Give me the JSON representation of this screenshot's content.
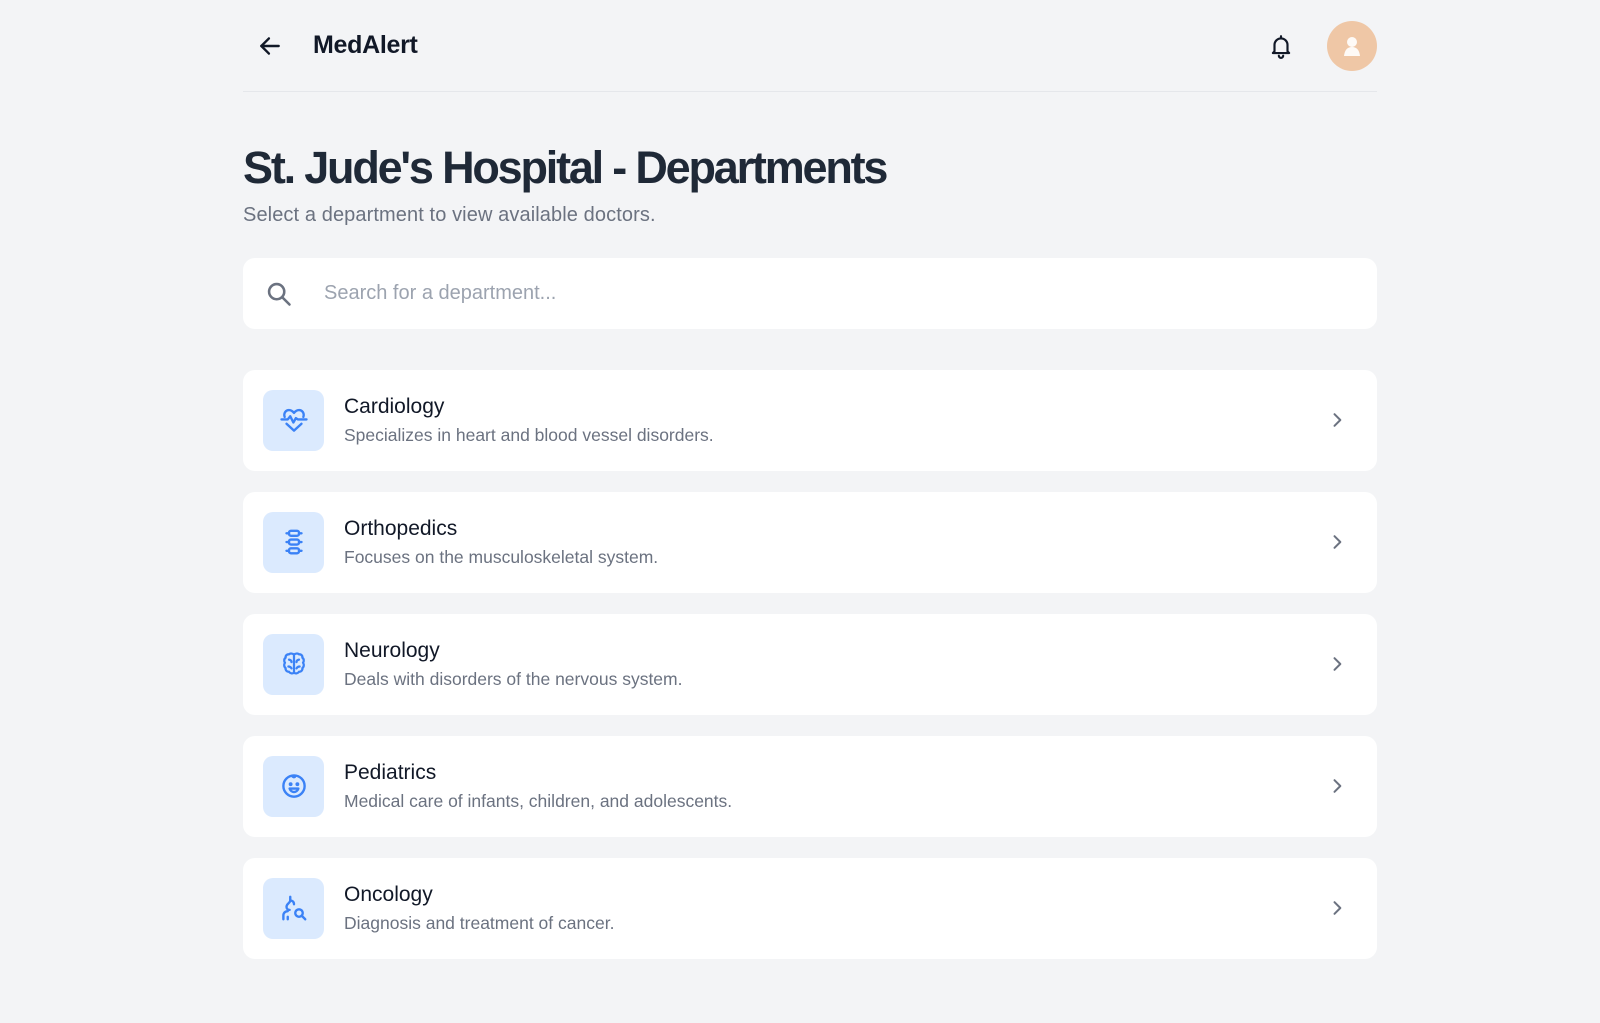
{
  "header": {
    "app_title": "MedAlert",
    "back_icon": "arrow-left-icon",
    "bell_icon": "bell-icon",
    "avatar_icon": "user-avatar"
  },
  "page": {
    "title": "St. Jude's Hospital - Departments",
    "subtitle": "Select a department to view available doctors."
  },
  "search": {
    "placeholder": "Search for a department...",
    "value": "",
    "icon": "search-icon"
  },
  "departments": [
    {
      "name": "Cardiology",
      "description": "Specializes in heart and blood vessel disorders.",
      "icon": "heart-pulse-icon"
    },
    {
      "name": "Orthopedics",
      "description": "Focuses on the musculoskeletal system.",
      "icon": "spine-icon"
    },
    {
      "name": "Neurology",
      "description": "Deals with disorders of the nervous system.",
      "icon": "brain-icon"
    },
    {
      "name": "Pediatrics",
      "description": "Medical care of infants, children, and adolescents.",
      "icon": "child-face-icon"
    },
    {
      "name": "Oncology",
      "description": "Diagnosis and treatment of cancer.",
      "icon": "microscope-search-icon"
    }
  ],
  "colors": {
    "background": "#f3f4f6",
    "accent": "#3b82f6",
    "icon_bg": "#dbeafe",
    "avatar_bg": "#efc7a6"
  }
}
